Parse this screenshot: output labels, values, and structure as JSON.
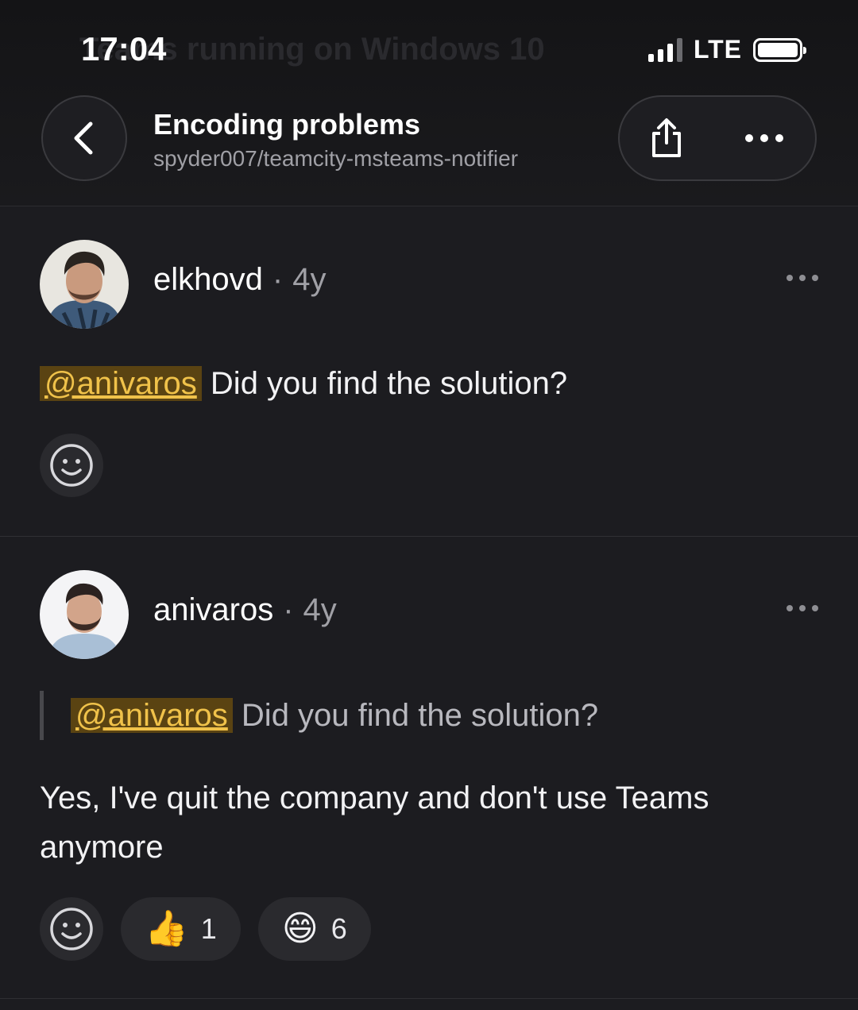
{
  "status_bar": {
    "time": "17:04",
    "network": "LTE"
  },
  "background_ghost": "Teams running on Windows 10",
  "header": {
    "title": "Encoding problems",
    "subtitle": "spyder007/teamcity-msteams-notifier",
    "back_icon": "chevron-left-icon",
    "share_icon": "share-icon",
    "more_icon": "more-icon"
  },
  "comments": [
    {
      "author": "elkhovd",
      "separator": "·",
      "age": "4y",
      "mention": "@anivaros",
      "text": "Did you find the solution?"
    },
    {
      "author": "anivaros",
      "separator": "·",
      "age": "4y",
      "quote_mention": "@anivaros",
      "quote_text": "Did you find the solution?",
      "text_line1": "Yes, I've quit the company and don't use Teams",
      "text_line2": "anymore",
      "reactions": [
        {
          "emoji": "👍",
          "count": "1"
        },
        {
          "emoji": "😄",
          "count": "6"
        }
      ]
    }
  ],
  "colors": {
    "mention_bg": "#5a4312",
    "mention_text": "#f0c24a",
    "background": "#1c1c20"
  }
}
